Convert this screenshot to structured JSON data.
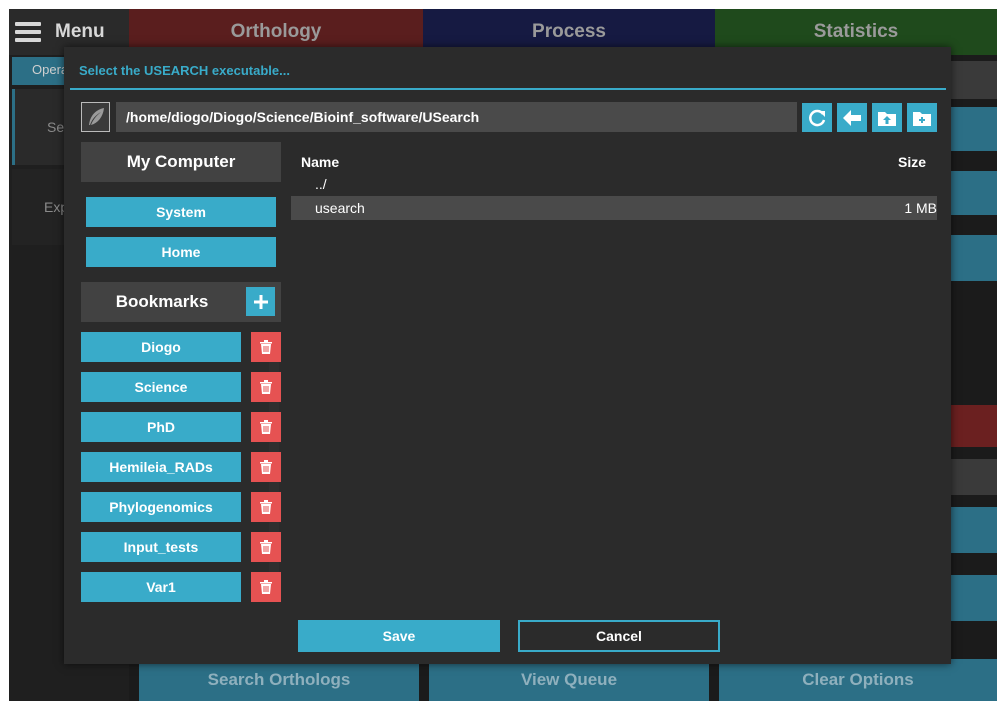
{
  "app": {
    "menu_label": "Menu",
    "tabs": [
      {
        "label": "Orthology"
      },
      {
        "label": "Process"
      },
      {
        "label": "Statistics"
      }
    ],
    "sidebar": {
      "operation_label": "Opera",
      "select_label": "Se",
      "explore_label": "Exp"
    },
    "bottom": {
      "search_label": "Search Orthologs",
      "queue_label": "View Queue",
      "clear_label": "Clear Options"
    }
  },
  "dialog": {
    "title": "Select the USEARCH executable...",
    "path": "/home/diogo/Diogo/Science/Bioinf_software/USearch",
    "my_computer_label": "My Computer",
    "locations": [
      {
        "label": "System"
      },
      {
        "label": "Home"
      }
    ],
    "bookmarks_label": "Bookmarks",
    "bookmarks": [
      {
        "label": "Diogo"
      },
      {
        "label": "Science"
      },
      {
        "label": "PhD"
      },
      {
        "label": "Hemileia_RADs"
      },
      {
        "label": "Phylogenomics"
      },
      {
        "label": "Input_tests"
      },
      {
        "label": "Var1"
      }
    ],
    "columns": {
      "name": "Name",
      "size": "Size"
    },
    "files": [
      {
        "name": "../",
        "size": ""
      },
      {
        "name": "usearch",
        "size": "1 MB"
      }
    ],
    "save_label": "Save",
    "cancel_label": "Cancel"
  },
  "colors": {
    "accent": "#39abc9",
    "delete": "#e65252",
    "dialog_bg": "#2b2b2b"
  },
  "icons": [
    "hamburger-icon",
    "feather-icon",
    "refresh-icon",
    "back-arrow-icon",
    "folder-up-icon",
    "new-folder-icon",
    "plus-icon",
    "trash-icon"
  ]
}
